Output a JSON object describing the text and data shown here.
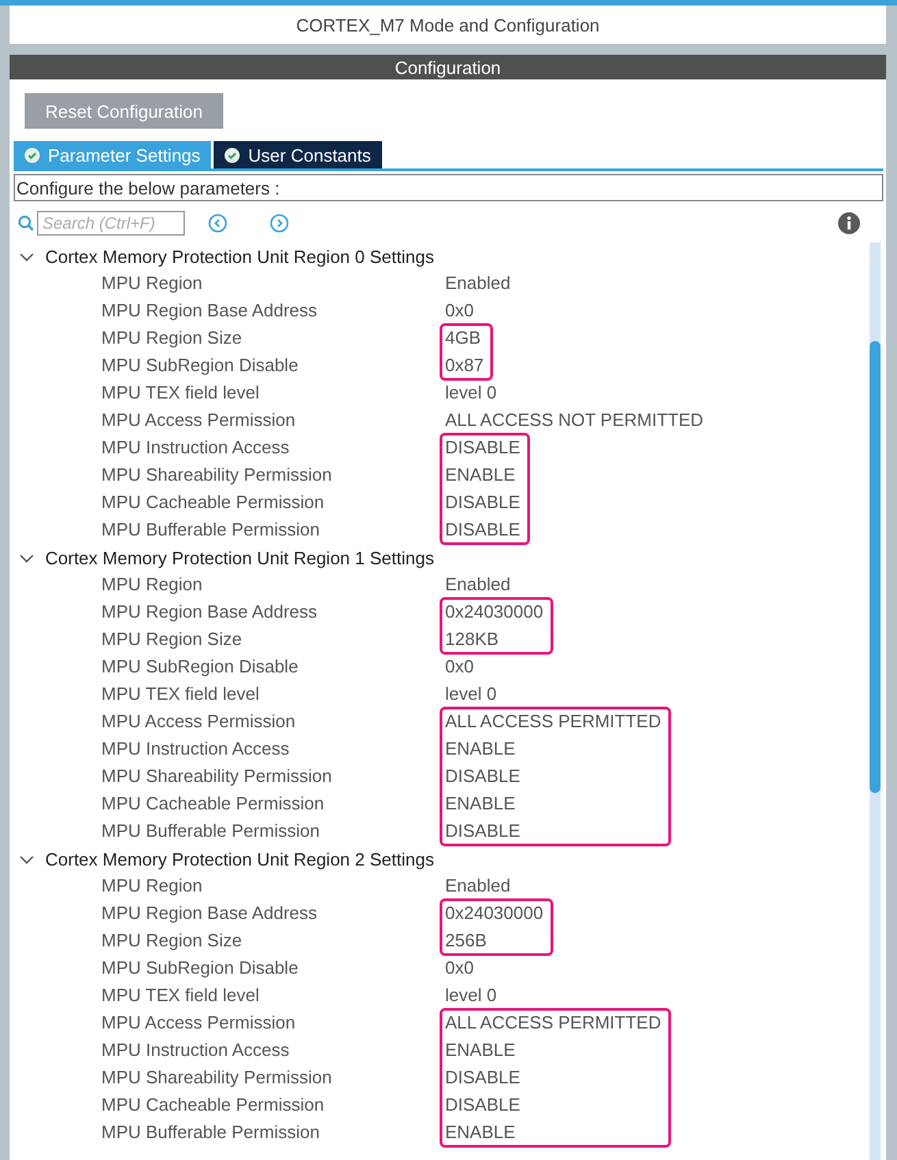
{
  "window": {
    "title": "CORTEX_M7 Mode and Configuration"
  },
  "panel": {
    "title": "Configuration",
    "reset_button": "Reset Configuration",
    "tabs": [
      {
        "label": "Parameter Settings",
        "selected": true
      },
      {
        "label": "User Constants",
        "selected": false
      }
    ],
    "hint": "Configure the below parameters :",
    "search": {
      "placeholder": "Search (Ctrl+F)"
    }
  },
  "sections": [
    {
      "title": "Cortex Memory Protection Unit Region 0 Settings",
      "expanded": true,
      "params": [
        {
          "name": "MPU Region",
          "value": "Enabled",
          "highlighted": false
        },
        {
          "name": "MPU Region Base Address",
          "value": "0x0",
          "highlighted": false
        },
        {
          "name": "MPU Region Size",
          "value": "4GB",
          "highlighted": true
        },
        {
          "name": "MPU SubRegion Disable",
          "value": "0x87",
          "highlighted": true
        },
        {
          "name": "MPU TEX field level",
          "value": "level 0",
          "highlighted": false
        },
        {
          "name": "MPU Access Permission",
          "value": "ALL ACCESS NOT PERMITTED",
          "highlighted": false
        },
        {
          "name": "MPU Instruction Access",
          "value": "DISABLE",
          "highlighted": true
        },
        {
          "name": "MPU Shareability Permission",
          "value": "ENABLE",
          "highlighted": true
        },
        {
          "name": "MPU Cacheable Permission",
          "value": "DISABLE",
          "highlighted": true
        },
        {
          "name": "MPU Bufferable  Permission",
          "value": "DISABLE",
          "highlighted": true
        }
      ]
    },
    {
      "title": "Cortex Memory Protection Unit Region 1 Settings",
      "expanded": true,
      "params": [
        {
          "name": "MPU Region",
          "value": "Enabled",
          "highlighted": false
        },
        {
          "name": "MPU Region Base Address",
          "value": "0x24030000",
          "highlighted": true
        },
        {
          "name": "MPU Region Size",
          "value": "128KB",
          "highlighted": true
        },
        {
          "name": "MPU SubRegion Disable",
          "value": "0x0",
          "highlighted": false
        },
        {
          "name": "MPU TEX field level",
          "value": "level 0",
          "highlighted": false
        },
        {
          "name": "MPU Access Permission",
          "value": "ALL ACCESS PERMITTED",
          "highlighted": true
        },
        {
          "name": "MPU Instruction Access",
          "value": "ENABLE",
          "highlighted": true
        },
        {
          "name": "MPU Shareability Permission",
          "value": "DISABLE",
          "highlighted": true
        },
        {
          "name": "MPU Cacheable Permission",
          "value": "ENABLE",
          "highlighted": true
        },
        {
          "name": "MPU Bufferable  Permission",
          "value": "DISABLE",
          "highlighted": true
        }
      ]
    },
    {
      "title": "Cortex Memory Protection Unit Region 2 Settings",
      "expanded": true,
      "params": [
        {
          "name": "MPU Region",
          "value": "Enabled",
          "highlighted": false
        },
        {
          "name": "MPU Region Base Address",
          "value": "0x24030000",
          "highlighted": true
        },
        {
          "name": "MPU Region Size",
          "value": "256B",
          "highlighted": true
        },
        {
          "name": "MPU SubRegion Disable",
          "value": "0x0",
          "highlighted": false
        },
        {
          "name": "MPU TEX field level",
          "value": "level 0",
          "highlighted": false
        },
        {
          "name": "MPU Access Permission",
          "value": "ALL ACCESS PERMITTED",
          "highlighted": true
        },
        {
          "name": "MPU Instruction Access",
          "value": "ENABLE",
          "highlighted": true
        },
        {
          "name": "MPU Shareability Permission",
          "value": "DISABLE",
          "highlighted": true
        },
        {
          "name": "MPU Cacheable Permission",
          "value": "DISABLE",
          "highlighted": true
        },
        {
          "name": "MPU Bufferable  Permission",
          "value": "ENABLE",
          "highlighted": true
        }
      ]
    }
  ]
}
